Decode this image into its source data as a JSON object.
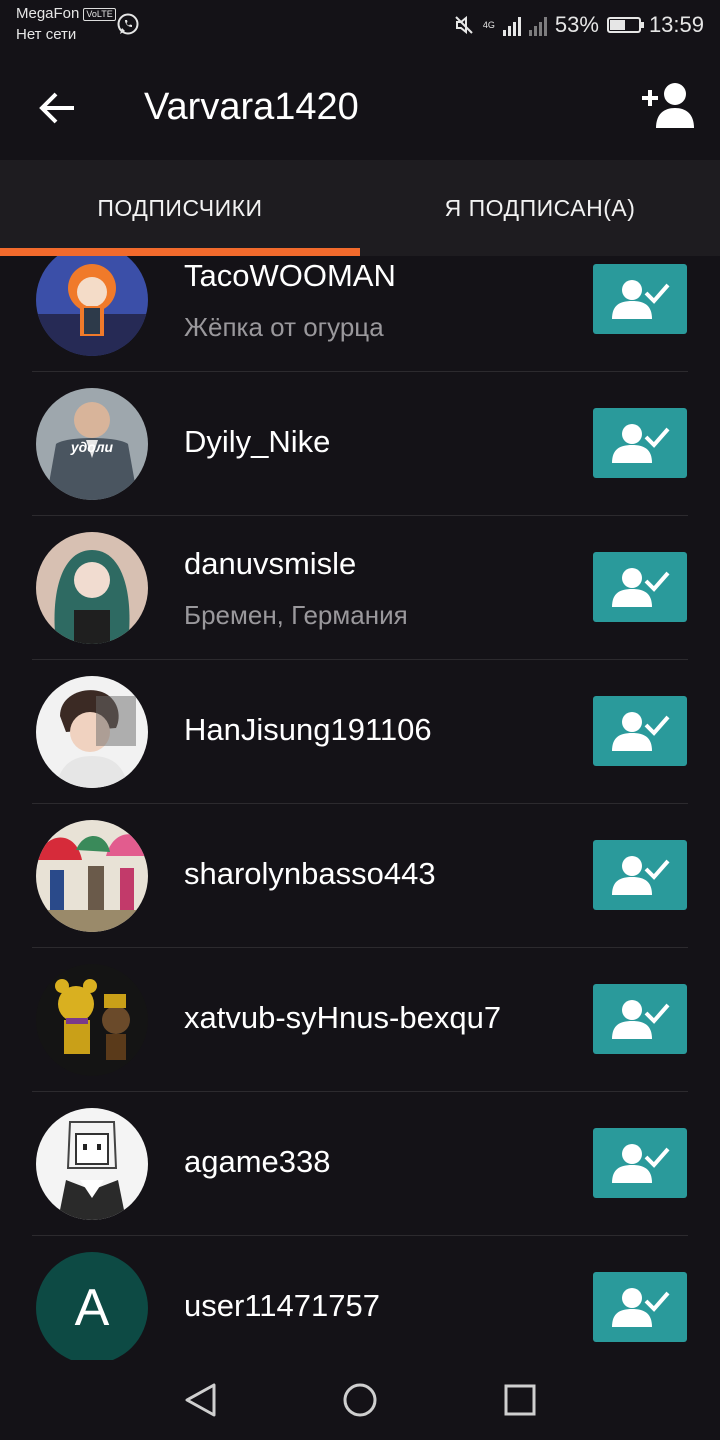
{
  "status": {
    "carrier": "MegaFon",
    "volte": "VoLTE",
    "network": "Нет сети",
    "net_type": "4G",
    "battery": "53%",
    "battery_level": 0.53,
    "time": "13:59"
  },
  "appbar": {
    "title": "Varvara1420"
  },
  "tabs": [
    {
      "label": "ПОДПИСЧИКИ",
      "active": true
    },
    {
      "label": "Я ПОДПИСАН(А)",
      "active": false
    }
  ],
  "users": [
    {
      "name": "TacoWOOMAN",
      "subtitle": "Жёпка от огурца"
    },
    {
      "name": "Dyily_Nike",
      "subtitle": "",
      "avatar_text": "удоли"
    },
    {
      "name": "danuvsmisle",
      "subtitle": "Бремен, Германия"
    },
    {
      "name": "HanJisung191106",
      "subtitle": ""
    },
    {
      "name": "sharolynbasso443",
      "subtitle": ""
    },
    {
      "name": "xatvub-syHnus-bexqu7",
      "subtitle": ""
    },
    {
      "name": "agame338",
      "subtitle": ""
    },
    {
      "name": "user11471757",
      "subtitle": "",
      "avatar_letter": "A"
    }
  ],
  "colors": {
    "accent": "#f26a2c",
    "follow_button": "#2a9a9b",
    "background": "#141217"
  },
  "icons": {
    "back": "arrow-left-icon",
    "add_user": "add-user-icon",
    "follow": "user-check-icon"
  }
}
